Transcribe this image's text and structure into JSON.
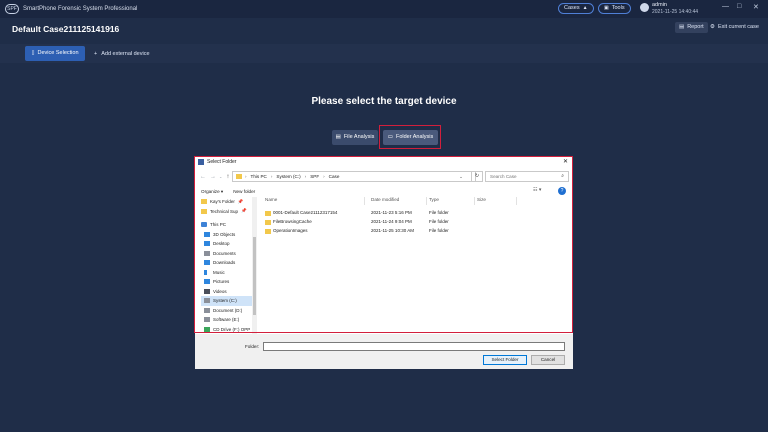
{
  "app": {
    "title": "SmartPhone Forensic System Professional",
    "logo_text": "SPF",
    "cases_label": "Cases",
    "tools_label": "Tools",
    "user_name": "admin",
    "user_time": "2021-11-25 14:40:44",
    "window_controls": [
      "—",
      "□",
      "✕"
    ]
  },
  "case": {
    "title": "Default Case211125141916",
    "report_label": "Report",
    "exit_label": "Exit current case"
  },
  "tabs": {
    "active_label": "Device Selection",
    "add_label": "Add external device"
  },
  "main": {
    "heading": "Please select the target device",
    "file_analysis_label": "File Analysis",
    "folder_analysis_label": "Folder Analysis"
  },
  "dialog": {
    "title": "Select Folder",
    "address": [
      "This PC",
      "System (C:)",
      "SPF",
      "Case"
    ],
    "search_placeholder": "Search Case",
    "organize_label": "Organize ▾",
    "new_folder_label": "New folder",
    "tree": [
      {
        "label": "Kay's Folder",
        "icon": "folder-icon",
        "pin": "📌"
      },
      {
        "label": "Technical Sup",
        "icon": "folder-icon",
        "pin": "📌"
      },
      {
        "label": "This PC",
        "icon": "pc-icon"
      },
      {
        "label": "3D Objects",
        "icon": "cube-icon"
      },
      {
        "label": "Desktop",
        "icon": "desktop-icon"
      },
      {
        "label": "Documents",
        "icon": "document-icon"
      },
      {
        "label": "Downloads",
        "icon": "download-icon"
      },
      {
        "label": "Music",
        "icon": "music-icon"
      },
      {
        "label": "Pictures",
        "icon": "picture-icon"
      },
      {
        "label": "Videos",
        "icon": "video-icon"
      },
      {
        "label": "System (C:)",
        "icon": "drive-icon"
      },
      {
        "label": "Document (D:)",
        "icon": "drive-icon"
      },
      {
        "label": "Software (E:)",
        "icon": "drive-icon"
      },
      {
        "label": "CD Drive (F:) OPP",
        "icon": "cd-icon"
      }
    ],
    "columns": [
      "Name",
      "Date modified",
      "Type",
      "Size"
    ],
    "files": [
      {
        "name": "0001-Default Case21112317154",
        "date": "2021-11-23 5:16 PM",
        "type": "File folder"
      },
      {
        "name": "FileBrowsingCache",
        "date": "2021-11-24 9:04 PM",
        "type": "File folder"
      },
      {
        "name": "OperationImages",
        "date": "2021-11-25 10:30 AM",
        "type": "File folder"
      }
    ],
    "folder_label": "Folder:",
    "folder_value": "",
    "select_button": "Select Folder",
    "cancel_button": "Cancel"
  }
}
